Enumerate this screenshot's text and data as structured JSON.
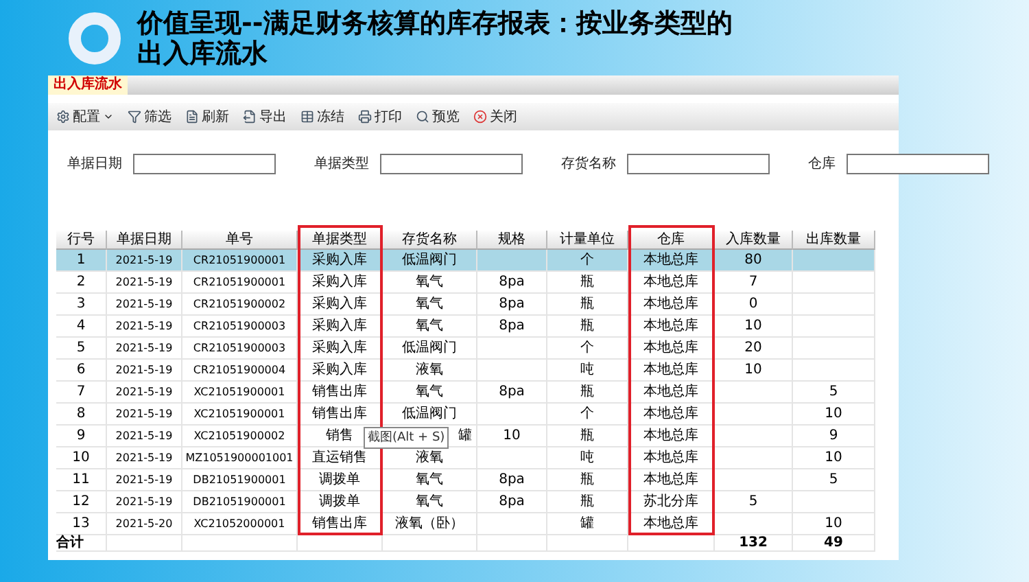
{
  "slide": {
    "title": "价值呈现--满足财务核算的库存报表：按业务类型的出入库流水"
  },
  "window": {
    "tab": "出入库流水",
    "toolbar": [
      {
        "label": "配置",
        "kind": "dropdown"
      },
      {
        "label": "筛选",
        "kind": "filter"
      },
      {
        "label": "刷新",
        "kind": "refresh"
      },
      {
        "label": "导出",
        "kind": "export"
      },
      {
        "label": "冻结",
        "kind": "freeze"
      },
      {
        "label": "打印",
        "kind": "print"
      },
      {
        "label": "预览",
        "kind": "preview"
      },
      {
        "label": "关闭",
        "kind": "close"
      }
    ],
    "filters": [
      {
        "label": "单据日期"
      },
      {
        "label": "单据类型"
      },
      {
        "label": "存货名称"
      },
      {
        "label": "仓库"
      }
    ],
    "table": {
      "columns": [
        {
          "label": "行号",
          "highlighted": false
        },
        {
          "label": "单据日期",
          "highlighted": false
        },
        {
          "label": "单号",
          "highlighted": false
        },
        {
          "label": "单据类型",
          "highlighted": true
        },
        {
          "label": "存货名称",
          "highlighted": false
        },
        {
          "label": "规格",
          "highlighted": false
        },
        {
          "label": "计量单位",
          "highlighted": false
        },
        {
          "label": "仓库",
          "highlighted": true
        },
        {
          "label": "入库数量",
          "highlighted": false
        },
        {
          "label": "出库数量",
          "highlighted": false
        }
      ],
      "rows": [
        {
          "selected": true,
          "cells": [
            "1",
            "2021-5-19",
            "CR21051900001",
            "采购入库",
            "低温阀门",
            "",
            "个",
            "本地总库",
            "80",
            ""
          ]
        },
        {
          "selected": false,
          "cells": [
            "2",
            "2021-5-19",
            "CR21051900001",
            "采购入库",
            "氧气",
            "8pa",
            "瓶",
            "本地总库",
            "7",
            ""
          ]
        },
        {
          "selected": false,
          "cells": [
            "3",
            "2021-5-19",
            "CR21051900002",
            "采购入库",
            "氧气",
            "8pa",
            "瓶",
            "本地总库",
            "0",
            ""
          ]
        },
        {
          "selected": false,
          "cells": [
            "4",
            "2021-5-19",
            "CR21051900003",
            "采购入库",
            "氧气",
            "8pa",
            "瓶",
            "本地总库",
            "10",
            ""
          ]
        },
        {
          "selected": false,
          "cells": [
            "5",
            "2021-5-19",
            "CR21051900003",
            "采购入库",
            "低温阀门",
            "",
            "个",
            "本地总库",
            "20",
            ""
          ]
        },
        {
          "selected": false,
          "cells": [
            "6",
            "2021-5-19",
            "CR21051900004",
            "采购入库",
            "液氧",
            "",
            "吨",
            "本地总库",
            "10",
            ""
          ]
        },
        {
          "selected": false,
          "cells": [
            "7",
            "2021-5-19",
            "XC21051900001",
            "销售出库",
            "氧气",
            "8pa",
            "瓶",
            "本地总库",
            "",
            "5"
          ]
        },
        {
          "selected": false,
          "cells": [
            "8",
            "2021-5-19",
            "XC21051900001",
            "销售出库",
            "低温阀门",
            "",
            "个",
            "本地总库",
            "",
            "10"
          ]
        },
        {
          "selected": false,
          "tooltip": "截图(Alt + S)",
          "cells": [
            "9",
            "2021-5-19",
            "XC21051900002",
            "销售",
            "罐",
            "10",
            "瓶",
            "本地总库",
            "",
            "9"
          ]
        },
        {
          "selected": false,
          "cells": [
            "10",
            "2021-5-19",
            "MZ1051900001001",
            "直运销售",
            "液氧",
            "",
            "吨",
            "本地总库",
            "",
            "10"
          ]
        },
        {
          "selected": false,
          "cells": [
            "11",
            "2021-5-19",
            "DB21051900001",
            "调拨单",
            "氧气",
            "8pa",
            "瓶",
            "本地总库",
            "",
            "5"
          ]
        },
        {
          "selected": false,
          "cells": [
            "12",
            "2021-5-19",
            "DB21051900001",
            "调拨单",
            "氧气",
            "8pa",
            "瓶",
            "苏北分库",
            "5",
            ""
          ]
        },
        {
          "selected": false,
          "cells": [
            "13",
            "2021-5-20",
            "XC21052000001",
            "销售出库",
            "液氧（卧）",
            "",
            "罐",
            "本地总库",
            "",
            "10"
          ]
        }
      ],
      "total": {
        "label": "合计",
        "in": "132",
        "out": "49"
      }
    }
  }
}
